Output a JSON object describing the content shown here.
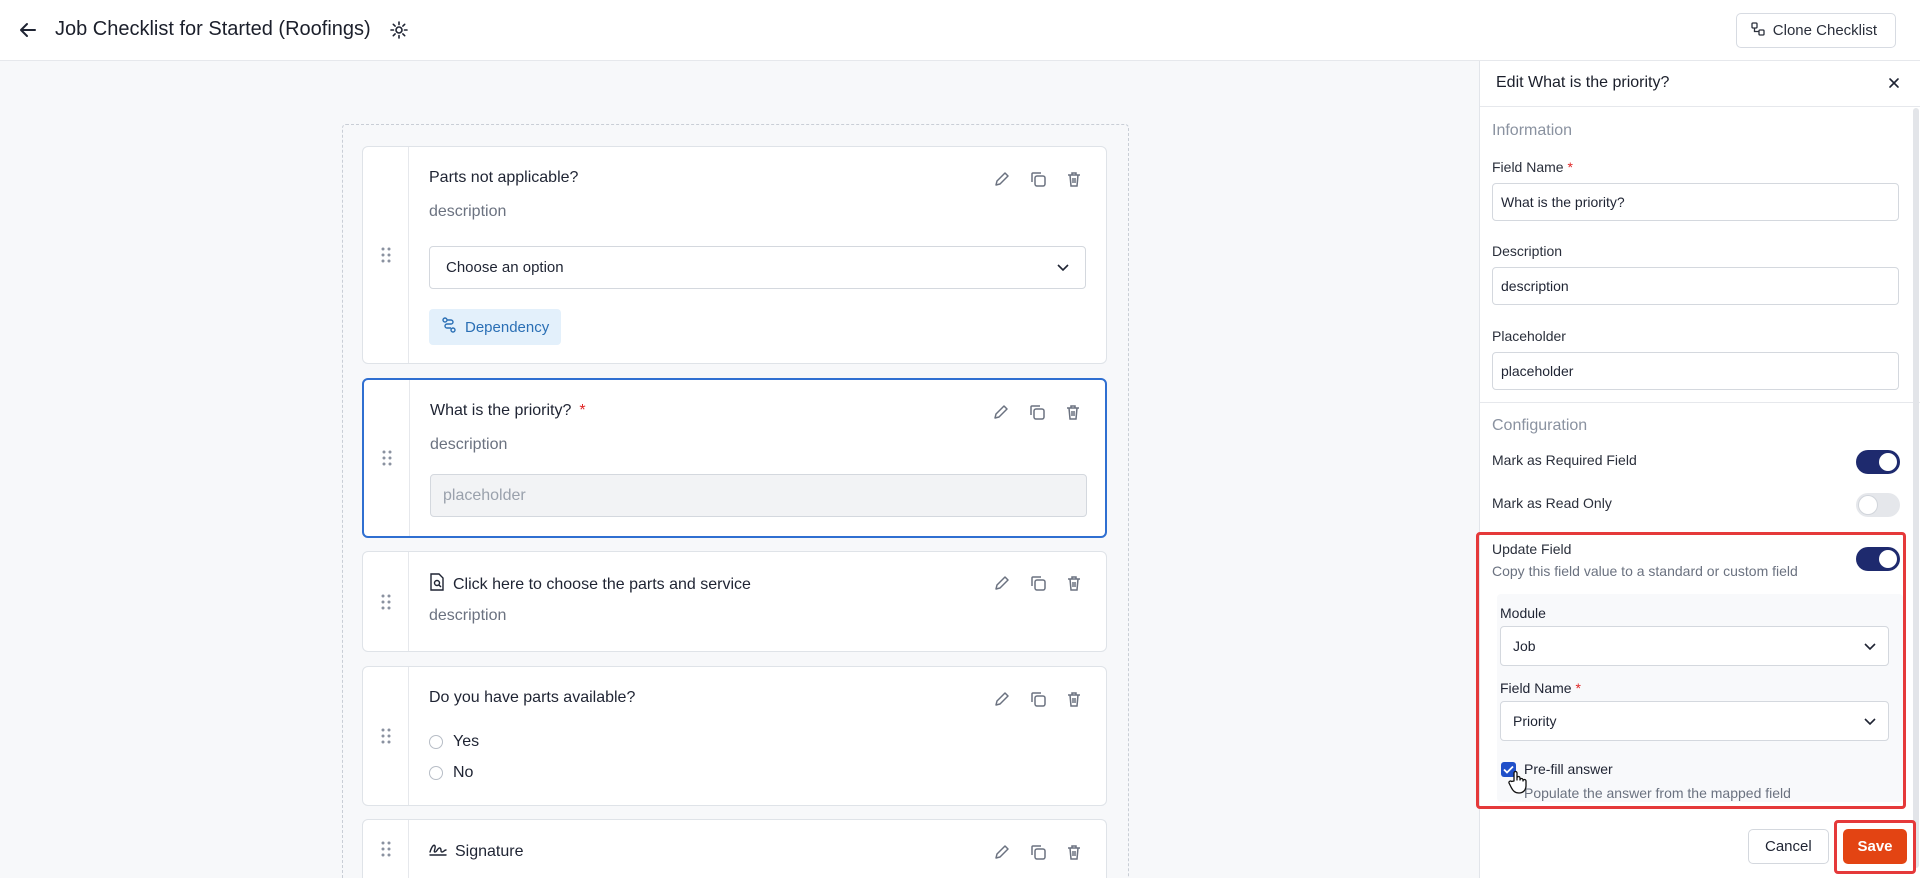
{
  "header": {
    "title": "Job Checklist for Started (Roofings)",
    "clone_label": "Clone Checklist"
  },
  "fields": [
    {
      "title": "Parts not applicable?",
      "description": "description",
      "select_value": "Choose an option",
      "dependency_label": "Dependency"
    },
    {
      "title": "What is the priority?",
      "required": "*",
      "description": "description",
      "placeholder": "placeholder"
    },
    {
      "title": "Click here to choose the parts and service",
      "description": "description"
    },
    {
      "title": "Do you have parts available?",
      "options": [
        "Yes",
        "No"
      ]
    },
    {
      "title": "Signature"
    }
  ],
  "panel": {
    "title": "Edit What is the priority?",
    "information_title": "Information",
    "field_name_label": "Field Name",
    "required_star": "*",
    "field_name_value": "What is the priority?",
    "description_label": "Description",
    "description_value": "description",
    "placeholder_label": "Placeholder",
    "placeholder_value": "placeholder",
    "configuration_title": "Configuration",
    "required_toggle_label": "Mark as Required Field",
    "required_toggle_on": true,
    "readonly_toggle_label": "Mark as Read Only",
    "readonly_toggle_on": false,
    "update_field_label": "Update Field",
    "update_field_help": "Copy this field value to a standard or custom field",
    "update_field_on": true,
    "module_label": "Module",
    "module_value": "Job",
    "mapped_field_label": "Field Name",
    "mapped_field_value": "Priority",
    "prefill_label": "Pre-fill answer",
    "prefill_help": "Populate the answer from the mapped field",
    "prefill_checked": true,
    "cancel_label": "Cancel",
    "save_label": "Save"
  },
  "colors": {
    "accent": "#1e2a6e",
    "save": "#e34413",
    "highlight": "#e5393a",
    "selected_border": "#2f6fd1"
  }
}
